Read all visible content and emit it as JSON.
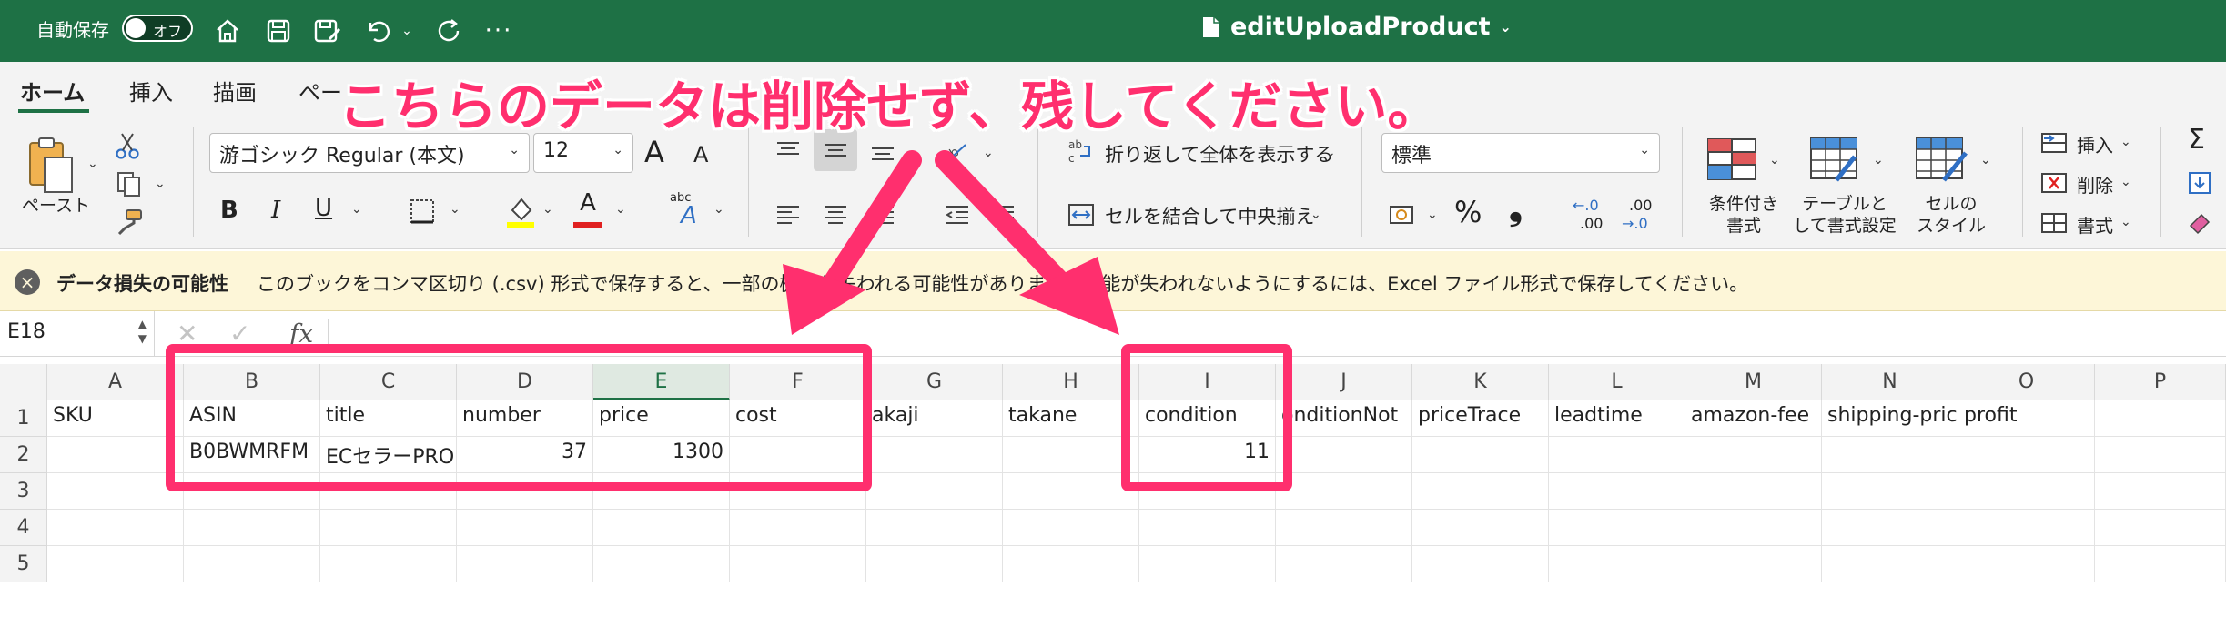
{
  "titlebar": {
    "autosave_label": "自動保存",
    "autosave_state": "オフ",
    "file_name": "editUploadProduct",
    "bg_color": "#1e7145"
  },
  "tabs": [
    {
      "label": "ホーム",
      "active": true
    },
    {
      "label": "挿入",
      "active": false
    },
    {
      "label": "描画",
      "active": false
    },
    {
      "label": "ペー",
      "active": false
    }
  ],
  "ribbon": {
    "paste_label": "ペースト",
    "font_name": "游ゴシック Regular (本文)",
    "font_size": "12",
    "wrap_text": "折り返して全体を表示する",
    "merge_center": "セルを結合して中央揃え",
    "number_format": "標準",
    "cond_format_1": "条件付き",
    "cond_format_2": "書式",
    "table_format_1": "テーブルと",
    "table_format_2": "して書式設定",
    "cell_style_1": "セルの",
    "cell_style_2": "スタイル",
    "insert_label": "挿入",
    "delete_label": "削除",
    "format_label": "書式",
    "bold": "B",
    "italic": "I",
    "underline": "U",
    "font_color_letter": "A",
    "abc_label": "abc",
    "percent": "%",
    "comma": "❟",
    "dec_inc": ".00",
    "dec_dec": ".0",
    "grow_font": "A",
    "shrink_font": "A",
    "sigma": "Σ"
  },
  "infobar": {
    "title": "データ損失の可能性",
    "message": "このブックをコンマ区切り (.csv) 形式で保存すると、一部の機能が失われる可能性があります。機能が失われないようにするには、Excel ファイル形式で保存してください。"
  },
  "formula_bar": {
    "name_box": "E18",
    "fx": "fx"
  },
  "sheet": {
    "columns": [
      "A",
      "B",
      "C",
      "D",
      "E",
      "F",
      "G",
      "H",
      "I",
      "J",
      "K",
      "L",
      "M",
      "N",
      "O",
      "P"
    ],
    "selected_column": "E",
    "rows": [
      "1",
      "2",
      "3",
      "4",
      "5"
    ],
    "row1": [
      "SKU",
      "ASIN",
      "title",
      "number",
      "price",
      "cost",
      "akaji",
      "takane",
      "condition",
      "onditionNot",
      "priceTrace",
      "leadtime",
      "amazon-fee",
      "shipping-pric",
      "profit",
      ""
    ],
    "row2": [
      "",
      "B0BWMRFM",
      "ECセラーPRO",
      "37",
      "1300",
      "",
      "",
      "",
      "11",
      "",
      "",
      "",
      "",
      "",
      "",
      ""
    ]
  },
  "annotation": {
    "callout": "こちらのデータは削除せず、残してください。",
    "color": "#ff2f6e"
  }
}
